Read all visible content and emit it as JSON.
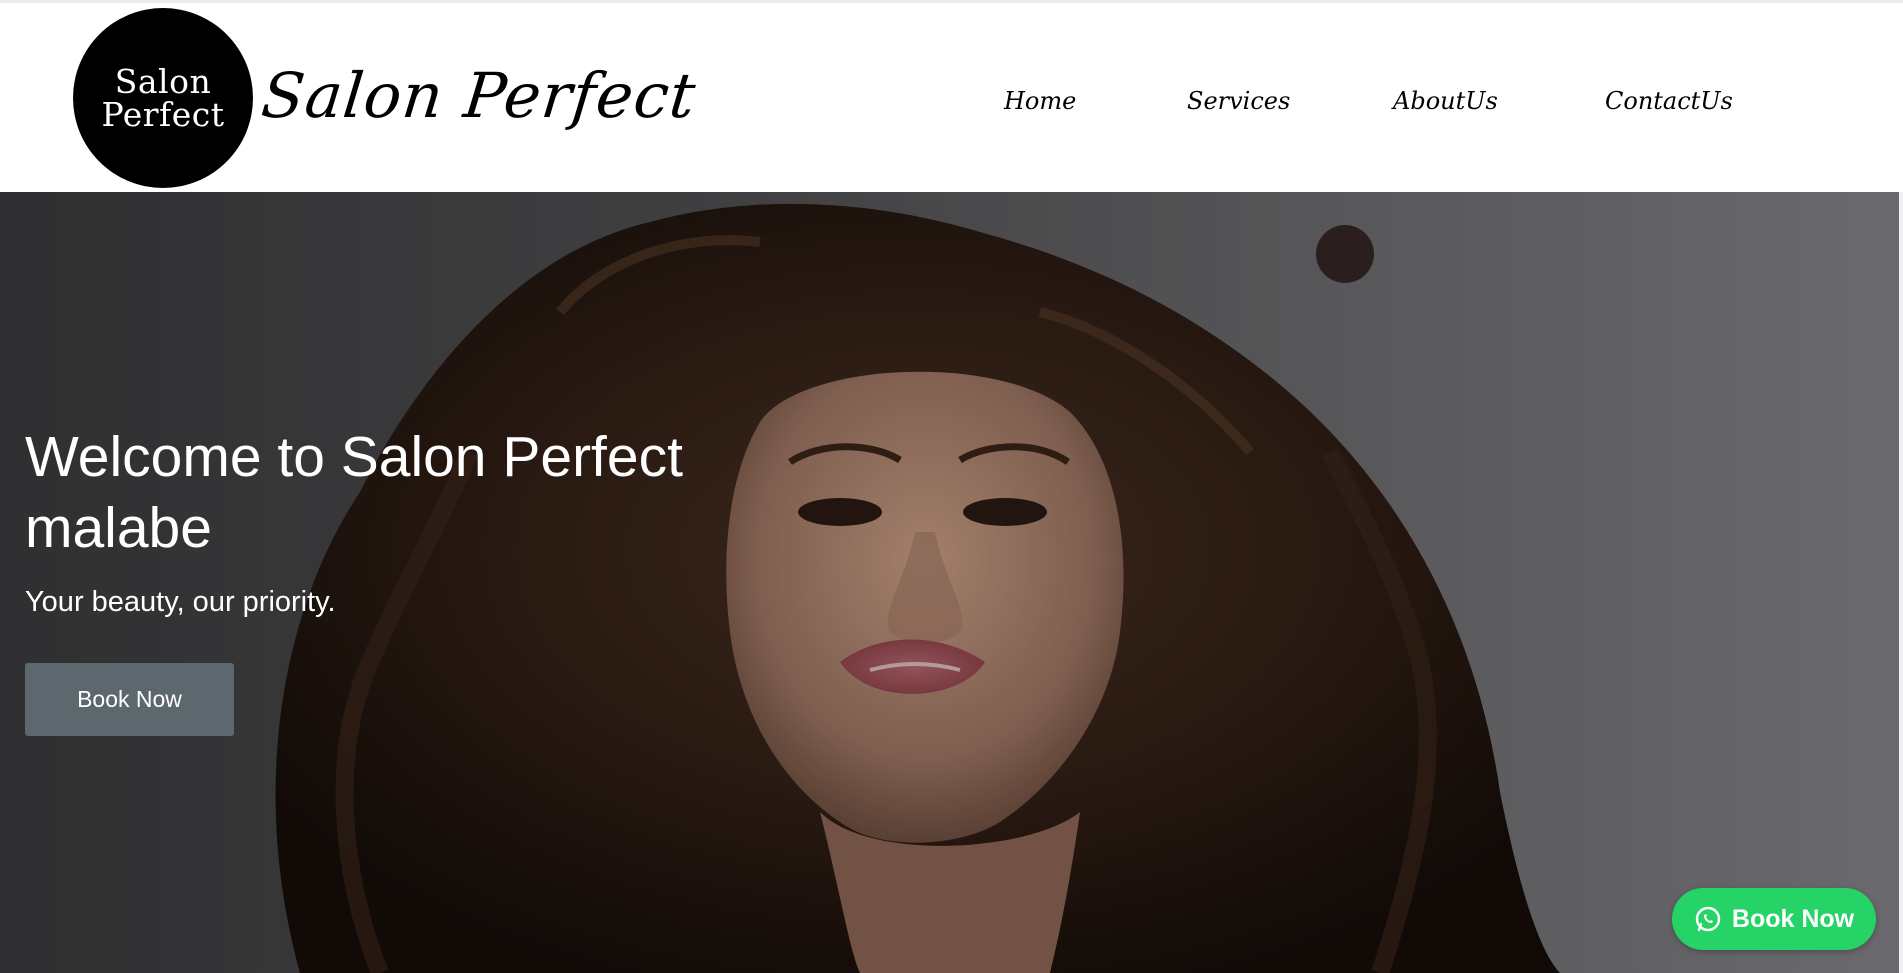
{
  "header": {
    "logo_lines": [
      "Salon",
      "Perfect"
    ],
    "brand_name": "Salon Perfect",
    "nav": [
      {
        "label": "Home"
      },
      {
        "label": "Services"
      },
      {
        "label": "AboutUs"
      },
      {
        "label": "ContactUs"
      }
    ]
  },
  "hero": {
    "title": "Welcome to Salon Perfect malabe",
    "subtitle": "Your beauty, our priority.",
    "cta_label": "Book Now"
  },
  "floating_button": {
    "label": "Book Now",
    "icon": "whatsapp-icon",
    "color": "#25d366"
  },
  "colors": {
    "header_bg": "#ffffff",
    "logo_bg": "#000000",
    "cta_bg": "#5c676e",
    "whatsapp_green": "#25d366"
  }
}
